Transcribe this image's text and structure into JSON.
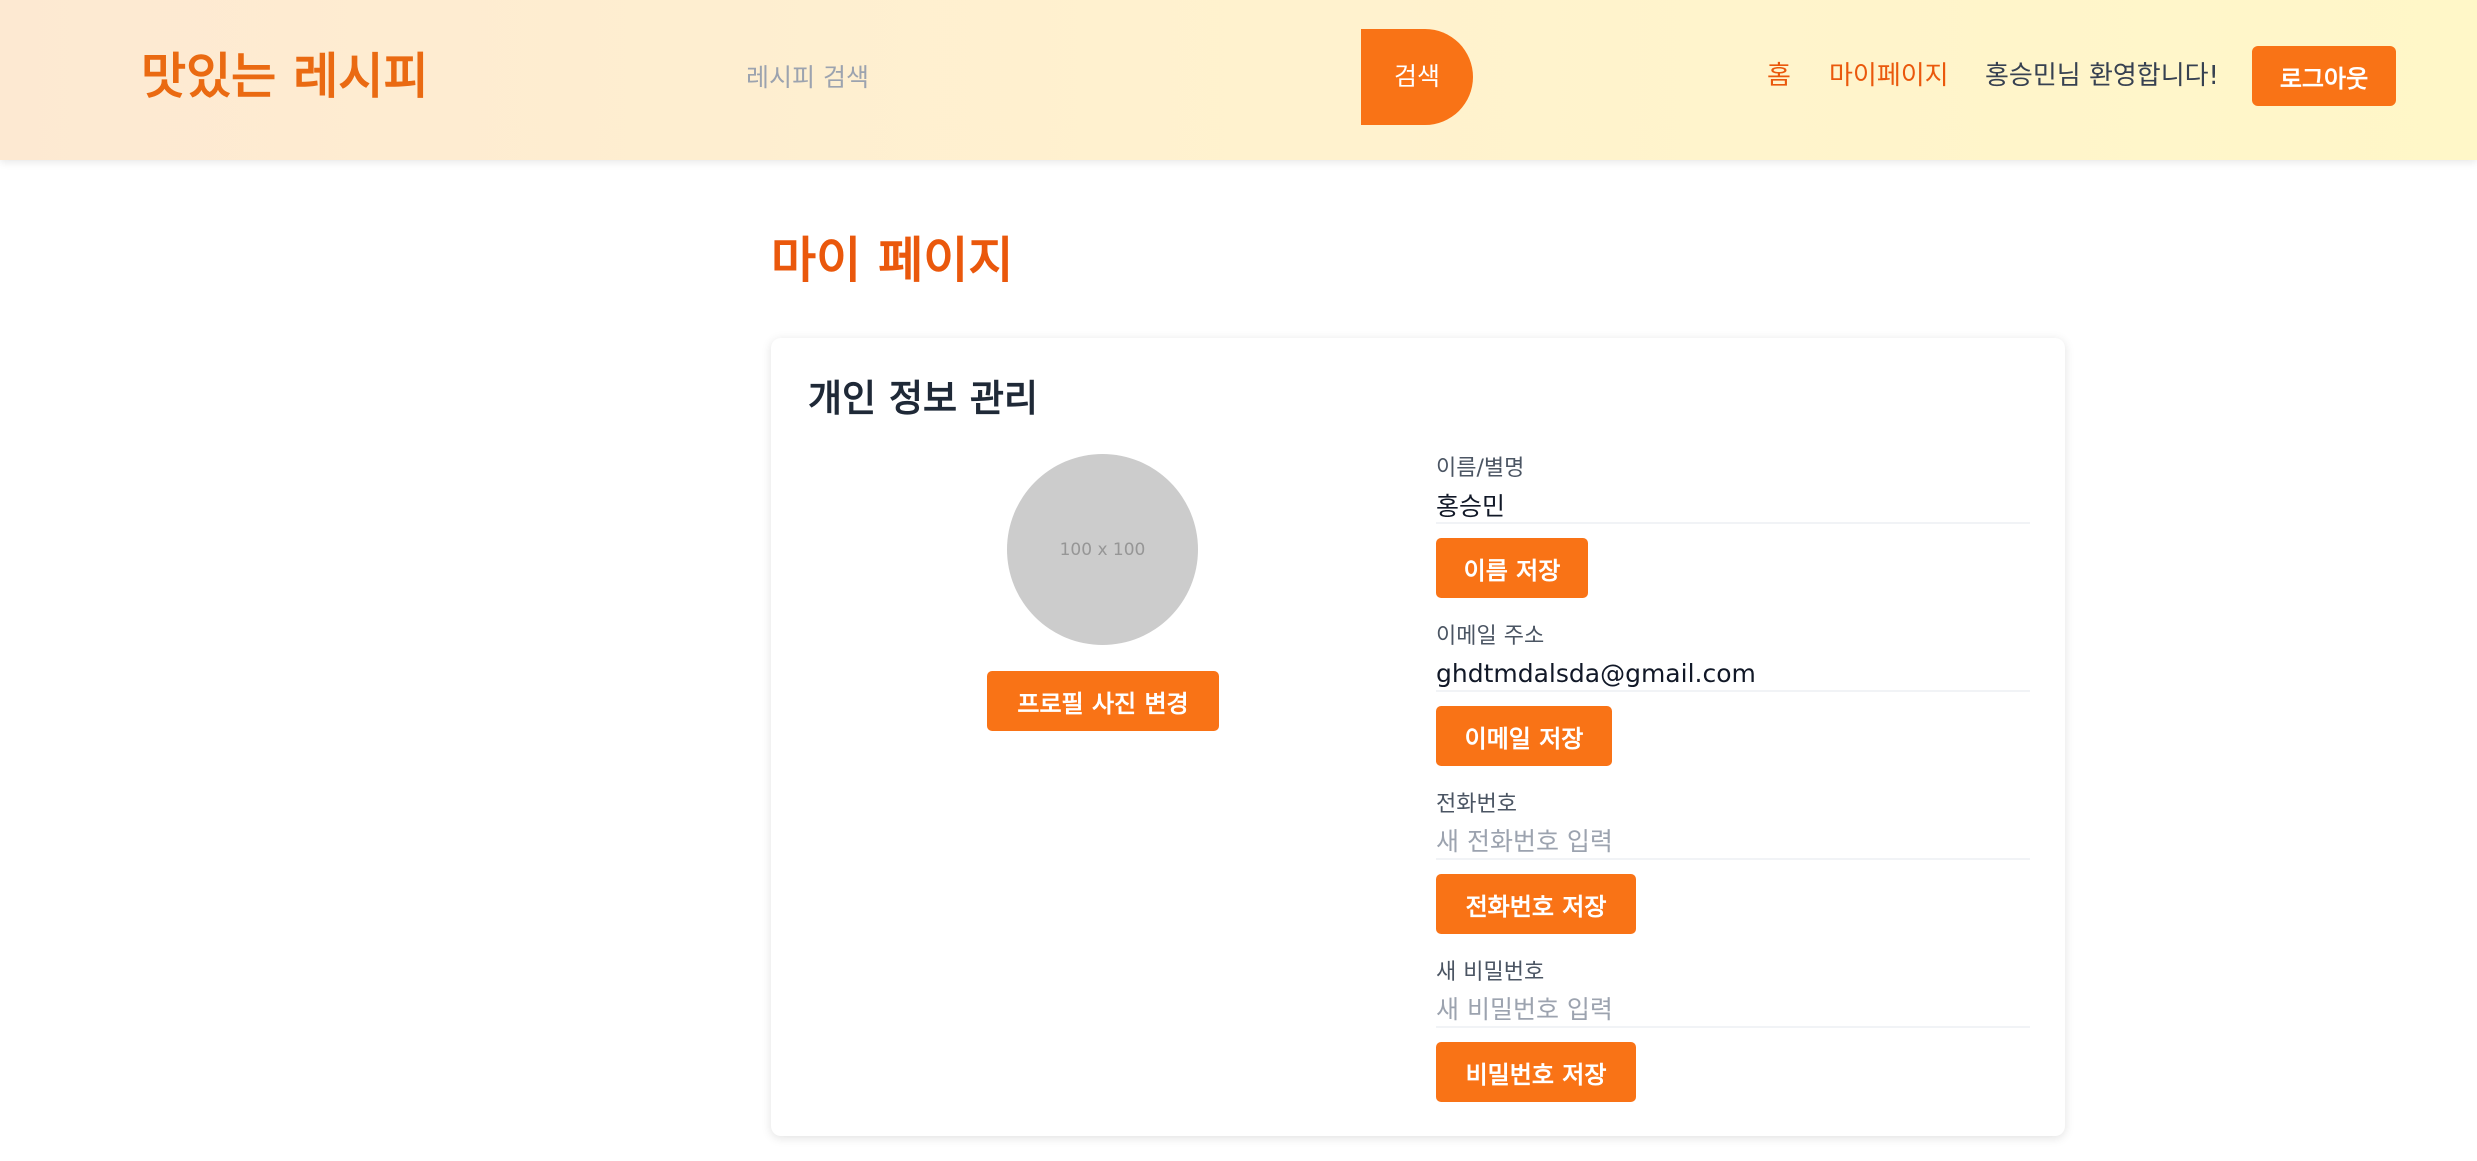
{
  "header": {
    "logo": "맛있는 레시피",
    "search_placeholder": "레시피 검색",
    "search_button": "검색",
    "nav": {
      "home": "홈",
      "mypage": "마이페이지",
      "welcome": "홍승민님 환영합니다!",
      "logout": "로그아웃"
    }
  },
  "page": {
    "title": "마이 페이지"
  },
  "profile": {
    "section_title": "개인 정보 관리",
    "avatar_placeholder": "100 x 100",
    "change_photo_button": "프로필 사진 변경",
    "fields": {
      "name": {
        "label": "이름/별명",
        "value": "홍승민",
        "save": "이름 저장"
      },
      "email": {
        "label": "이메일 주소",
        "value": "ghdtmdalsda@gmail.com",
        "save": "이메일 저장"
      },
      "phone": {
        "label": "전화번호",
        "placeholder": "새 전화번호 입력",
        "save": "전화번호 저장"
      },
      "password": {
        "label": "새 비밀번호",
        "placeholder": "새 비밀번호 입력",
        "save": "비밀번호 저장"
      }
    }
  },
  "colors": {
    "accent": "#f97316",
    "title": "#ea580c"
  }
}
